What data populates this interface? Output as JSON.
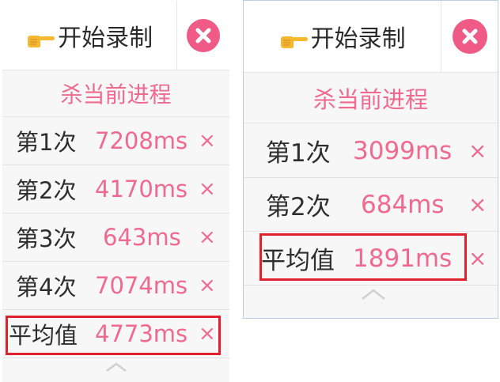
{
  "left_panel": {
    "start_label": "开始录制",
    "kill_label": "杀当前进程",
    "rows": [
      {
        "label": "第1次",
        "value": "7208ms",
        "delete": "×"
      },
      {
        "label": "第2次",
        "value": "4170ms",
        "delete": "×"
      },
      {
        "label": "第3次",
        "value": "643ms",
        "delete": "×"
      },
      {
        "label": "第4次",
        "value": "7074ms",
        "delete": "×"
      },
      {
        "label": "平均值",
        "value": "4773ms",
        "delete": "×"
      }
    ]
  },
  "right_panel": {
    "start_label": "开始录制",
    "kill_label": "杀当前进程",
    "rows": [
      {
        "label": "第1次",
        "value": "3099ms",
        "delete": "×"
      },
      {
        "label": "第2次",
        "value": "684ms",
        "delete": "×"
      },
      {
        "label": "平均值",
        "value": "1891ms",
        "delete": "×"
      }
    ]
  },
  "icons": {
    "start": "pointing-hand-icon",
    "close": "close-circle-icon",
    "collapse": "chevron-up-icon"
  },
  "colors": {
    "accent_pink": "#f06a90",
    "close_pink": "#f05a87",
    "highlight_red": "#e0202a",
    "panel_bg": "#f7f7f7",
    "text_dark": "#2e2e2e",
    "hand_yellow": "#f5b82e"
  }
}
